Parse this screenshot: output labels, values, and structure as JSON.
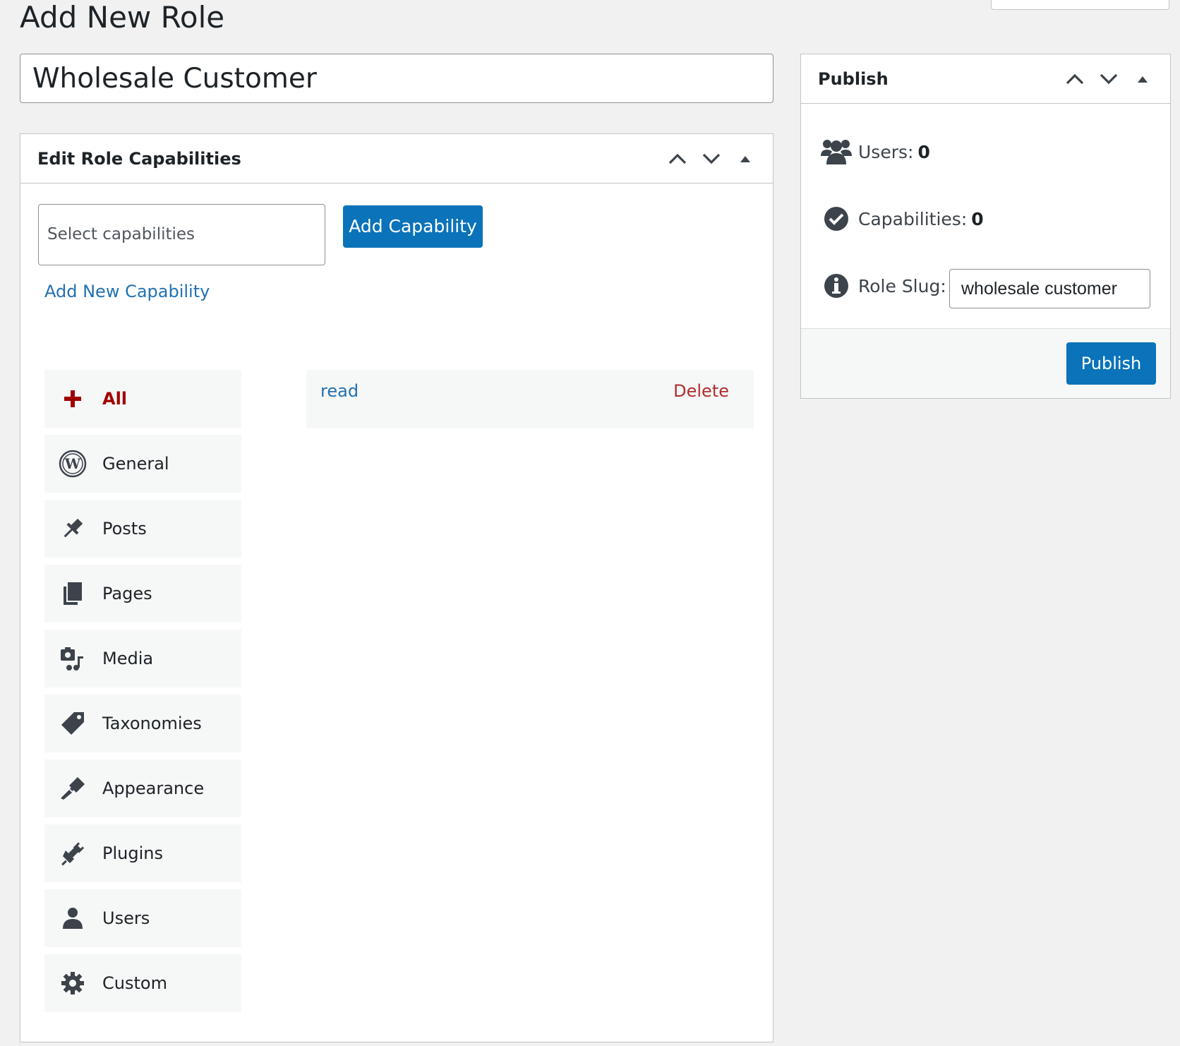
{
  "page": {
    "title": "Add New Role"
  },
  "role": {
    "name": "Wholesale Customer"
  },
  "capabilities_box": {
    "title": "Edit Role Capabilities",
    "select_placeholder": "Select capabilities",
    "add_button": "Add Capability",
    "add_new_link": "Add New Capability",
    "categories": [
      {
        "label": "All",
        "icon": "plus-icon",
        "active": true
      },
      {
        "label": "General",
        "icon": "wordpress-icon"
      },
      {
        "label": "Posts",
        "icon": "pushpin-icon"
      },
      {
        "label": "Pages",
        "icon": "pages-icon"
      },
      {
        "label": "Media",
        "icon": "media-icon"
      },
      {
        "label": "Taxonomies",
        "icon": "tag-icon"
      },
      {
        "label": "Appearance",
        "icon": "paintbrush-icon"
      },
      {
        "label": "Plugins",
        "icon": "plugin-icon"
      },
      {
        "label": "Users",
        "icon": "user-icon"
      },
      {
        "label": "Custom",
        "icon": "gear-icon"
      }
    ],
    "assigned": [
      {
        "name": "read",
        "delete_label": "Delete"
      }
    ]
  },
  "publish_box": {
    "title": "Publish",
    "users_label": "Users:",
    "users_count": "0",
    "capabilities_label": "Capabilities:",
    "capabilities_count": "0",
    "slug_label": "Role Slug:",
    "slug_value": "wholesale customer",
    "publish_button": "Publish"
  },
  "colors": {
    "primary": "#0a73b9",
    "link": "#2271b1",
    "active_category": "#a00000",
    "delete": "#b32d2e",
    "background": "#f1f1f1"
  }
}
